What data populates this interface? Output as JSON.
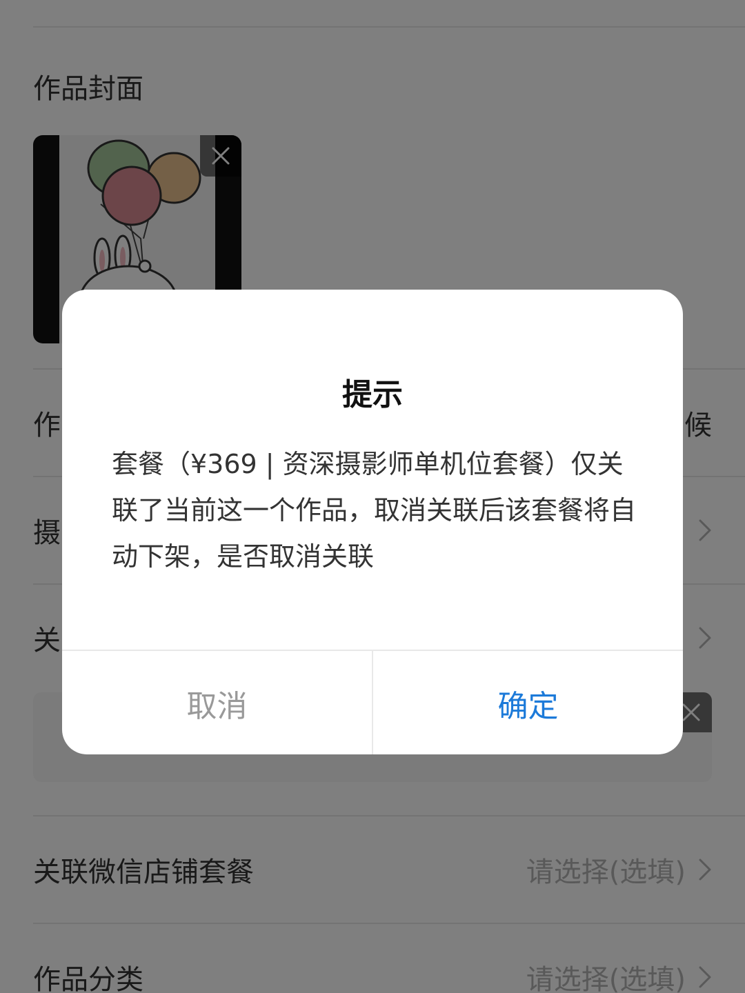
{
  "form": {
    "cover_title": "作品封面",
    "row_work_prefix": "作",
    "row_work_suffix": "候",
    "row_photographer_prefix": "摄",
    "row_assoc_prefix": "关",
    "wechat_package_label": "关联微信店铺套餐",
    "wechat_package_placeholder": "请选择(选填)",
    "category_label": "作品分类",
    "category_placeholder": "请选择(选填)"
  },
  "dialog": {
    "title": "提示",
    "message": "套餐（¥369 | 资深摄影师单机位套餐）仅关联了当前这一个作品，取消关联后该套餐将自动下架，是否取消关联",
    "cancel_label": "取消",
    "confirm_label": "确定"
  },
  "colors": {
    "confirm_accent": "#1c7ad9",
    "cancel_text": "#999999",
    "mask": "rgba(0,0,0,0.5)"
  },
  "icons": {
    "remove_cover": "close-icon",
    "remove_assoc": "close-icon",
    "row_arrow": "chevron-right-icon"
  }
}
